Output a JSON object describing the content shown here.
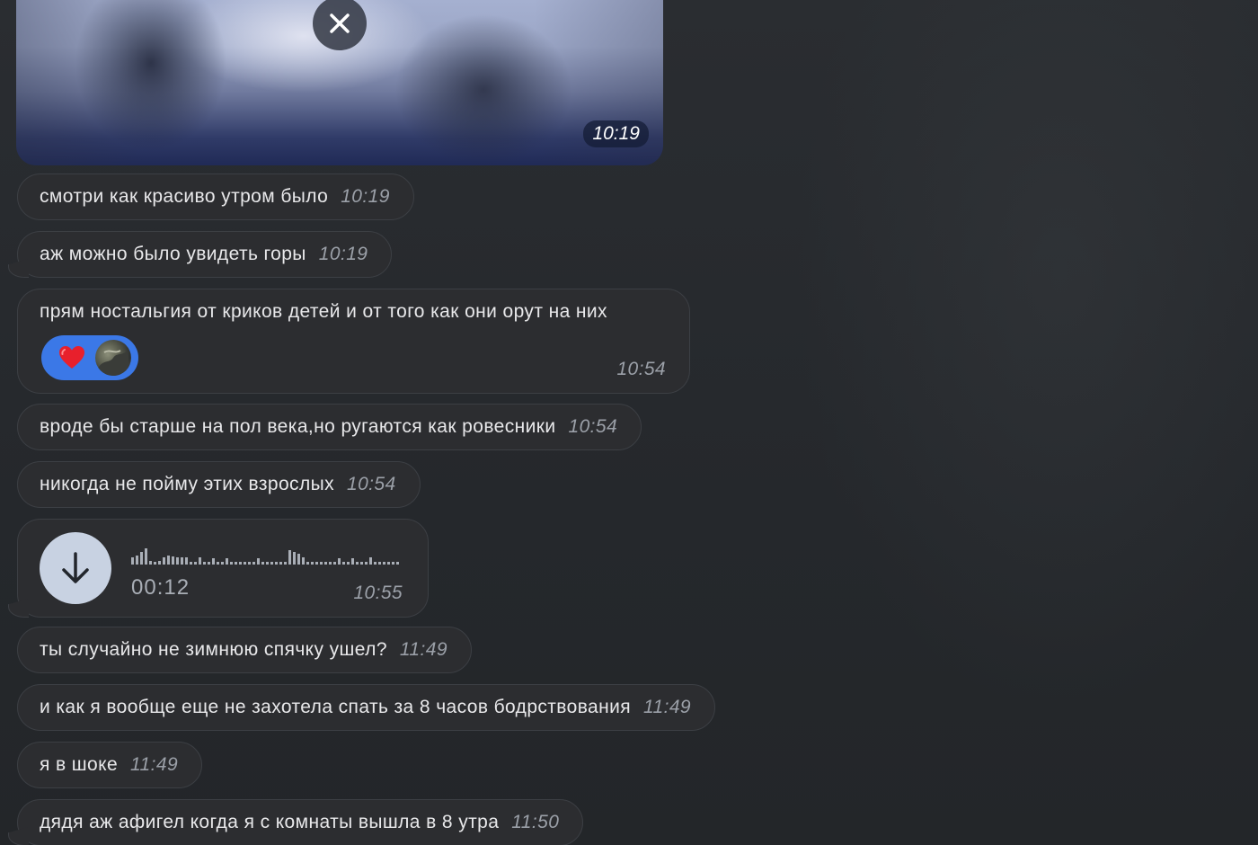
{
  "media": {
    "time": "10:19",
    "close_icon": "close-icon"
  },
  "messages": [
    {
      "text": "смотри как красиво утром было",
      "time": "10:19"
    },
    {
      "text": "аж можно было увидеть горы",
      "time": "10:19"
    },
    {
      "text": "прям ностальгия от криков детей и от того как они орут на них",
      "time": "10:54",
      "reaction": {
        "emoji": "❤️",
        "icon": "heart-icon"
      }
    },
    {
      "text": "вроде бы старше на пол века,но ругаются как ровесники",
      "time": "10:54"
    },
    {
      "text": "никогда не пойму этих взрослых",
      "time": "10:54"
    },
    {
      "voice": {
        "duration": "00:12",
        "time": "10:55",
        "icon": "download-arrow-icon"
      }
    },
    {
      "text": "ты случайно не зимнюю спячку ушел?",
      "time": "11:49"
    },
    {
      "text": "и как я вообще еще не захотела спать за 8 часов бодрствования",
      "time": "11:49"
    },
    {
      "text": "я в шоке",
      "time": "11:49"
    },
    {
      "text": "дядя аж афигел когда я с комнаты вышла в 8 утра",
      "time": "11:50"
    }
  ],
  "colors": {
    "background": "#26292d",
    "bubble": "#2c2d30",
    "bubble_border": "#3c3f44",
    "reaction": "#3b78e7",
    "time_text": "#9ba0a8"
  }
}
